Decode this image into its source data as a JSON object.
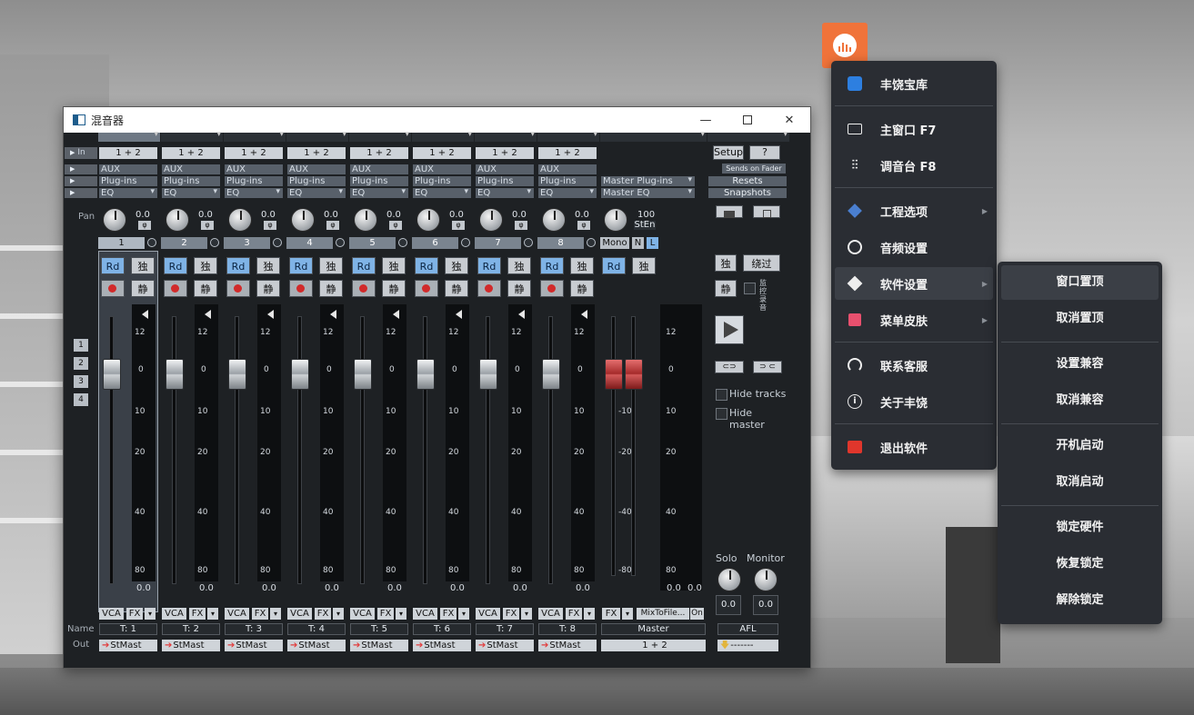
{
  "window": {
    "title": "混音器"
  },
  "row_labels": {
    "in": "In",
    "pan": "Pan",
    "name": "Name",
    "out": "Out"
  },
  "channels": [
    {
      "num": "1",
      "input": "1 + 2",
      "aux": "AUX",
      "plugins": "Plug-ins",
      "eq": "EQ",
      "pan": "0.0",
      "rd": "Rd",
      "solo": "独",
      "mute": "静",
      "db": "0.0",
      "vca": "VCA",
      "fx": "FX",
      "name": "T: 1",
      "out": "StMast"
    },
    {
      "num": "2",
      "input": "1 + 2",
      "aux": "AUX",
      "plugins": "Plug-ins",
      "eq": "EQ",
      "pan": "0.0",
      "rd": "Rd",
      "solo": "独",
      "mute": "静",
      "db": "0.0",
      "vca": "VCA",
      "fx": "FX",
      "name": "T: 2",
      "out": "StMast"
    },
    {
      "num": "3",
      "input": "1 + 2",
      "aux": "AUX",
      "plugins": "Plug-ins",
      "eq": "EQ",
      "pan": "0.0",
      "rd": "Rd",
      "solo": "独",
      "mute": "静",
      "db": "0.0",
      "vca": "VCA",
      "fx": "FX",
      "name": "T: 3",
      "out": "StMast"
    },
    {
      "num": "4",
      "input": "1 + 2",
      "aux": "AUX",
      "plugins": "Plug-ins",
      "eq": "EQ",
      "pan": "0.0",
      "rd": "Rd",
      "solo": "独",
      "mute": "静",
      "db": "0.0",
      "vca": "VCA",
      "fx": "FX",
      "name": "T: 4",
      "out": "StMast"
    },
    {
      "num": "5",
      "input": "1 + 2",
      "aux": "AUX",
      "plugins": "Plug-ins",
      "eq": "EQ",
      "pan": "0.0",
      "rd": "Rd",
      "solo": "独",
      "mute": "静",
      "db": "0.0",
      "vca": "VCA",
      "fx": "FX",
      "name": "T: 5",
      "out": "StMast"
    },
    {
      "num": "6",
      "input": "1 + 2",
      "aux": "AUX",
      "plugins": "Plug-ins",
      "eq": "EQ",
      "pan": "0.0",
      "rd": "Rd",
      "solo": "独",
      "mute": "静",
      "db": "0.0",
      "vca": "VCA",
      "fx": "FX",
      "name": "T: 6",
      "out": "StMast"
    },
    {
      "num": "7",
      "input": "1 + 2",
      "aux": "AUX",
      "plugins": "Plug-ins",
      "eq": "EQ",
      "pan": "0.0",
      "rd": "Rd",
      "solo": "独",
      "mute": "静",
      "db": "0.0",
      "vca": "VCA",
      "fx": "FX",
      "name": "T: 7",
      "out": "StMast"
    },
    {
      "num": "8",
      "input": "1 + 2",
      "aux": "AUX",
      "plugins": "Plug-ins",
      "eq": "EQ",
      "pan": "0.0",
      "rd": "Rd",
      "solo": "独",
      "mute": "静",
      "db": "0.0",
      "vca": "VCA",
      "fx": "FX",
      "name": "T: 8",
      "out": "StMast"
    }
  ],
  "channel_scale": [
    "12",
    "0",
    "10",
    "20",
    "40",
    "80"
  ],
  "phase_symbol": "φ",
  "master": {
    "plugins": "Master Plug-ins",
    "eq": "Master EQ",
    "pan": "100",
    "st_en": "StEn",
    "mono": "Mono",
    "n": "N",
    "l": "L",
    "rd": "Rd",
    "solo": "独",
    "scale_left": [
      "-10",
      "-20",
      "-40",
      "-80"
    ],
    "scale_right": [
      "12",
      "0",
      "10",
      "20",
      "40",
      "80"
    ],
    "db_left": "0.0",
    "db_right": "0.0",
    "fx": "FX",
    "mixtofile": "MixToFile...",
    "on": "On",
    "name": "Master",
    "out": "1 + 2"
  },
  "control_panel": {
    "setup": "Setup",
    "help": "?",
    "sends_on_fader": "Sends on Fader",
    "resets": "Resets",
    "snapshots": "Snapshots",
    "solo": "独",
    "bypass": "绕过",
    "mute": "静",
    "monitor_rec": "监控录音",
    "hide_tracks": "Hide tracks",
    "hide_master": "Hide master",
    "solo_label": "Solo",
    "monitor_label": "Monitor",
    "solo_val": "0.0",
    "monitor_val": "0.0",
    "afl": "AFL",
    "afl_out": "-------"
  },
  "group_buttons": [
    "1",
    "2",
    "3",
    "4"
  ],
  "tray_menu": {
    "items": [
      {
        "label": "丰饶宝库",
        "icon": "library-icon"
      },
      {
        "label": "主窗口  F7",
        "icon": "window-icon"
      },
      {
        "label": "调音台  F8",
        "icon": "mixer-sliders-icon"
      },
      {
        "label": "工程选项",
        "icon": "layers-icon"
      },
      {
        "label": "音频设置",
        "icon": "audio-settings-icon"
      },
      {
        "label": "软件设置",
        "icon": "box-icon"
      },
      {
        "label": "菜单皮肤",
        "icon": "shirt-icon"
      },
      {
        "label": "联系客服",
        "icon": "headset-icon"
      },
      {
        "label": "关于丰饶",
        "icon": "info-icon"
      },
      {
        "label": "退出软件",
        "icon": "exit-icon"
      }
    ]
  },
  "submenu": {
    "items": [
      "窗口置顶",
      "取消置顶",
      "设置兼容",
      "取消兼容",
      "开机启动",
      "取消启动",
      "锁定硬件",
      "恢复锁定",
      "解除锁定"
    ]
  },
  "colors": {
    "tray_accent": "#f0733a",
    "rd_button": "#7fb3e6",
    "record": "#d12a2a",
    "exit_icon": "#e0362c"
  }
}
